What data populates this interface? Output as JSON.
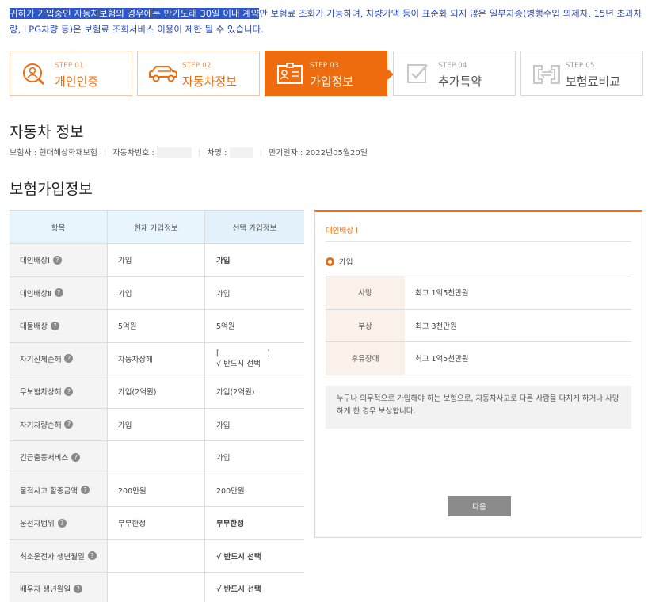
{
  "notice": {
    "highlight": "귀하가 가입중인 자동차보험의 경우에는 만기도래 30일 이내 계약",
    "rest": "만 보험료 조회가 가능하며, 차량가액 등이 표준화 되지 않은 일부차종(병행수입 외제차, 15년 초과차량, LPG차량 등)은 보험료 조회서비스 이용이 제한 될 수 있습니다."
  },
  "steps": [
    {
      "num": "STEP 01",
      "label": "개인인증",
      "state": "done",
      "icon": "person-search-icon"
    },
    {
      "num": "STEP 02",
      "label": "자동차정보",
      "state": "done",
      "icon": "car-icon"
    },
    {
      "num": "STEP 03",
      "label": "가입정보",
      "state": "active",
      "icon": "id-card-icon"
    },
    {
      "num": "STEP 04",
      "label": "추가특약",
      "state": "todo",
      "icon": "checkbox-icon"
    },
    {
      "num": "STEP 05",
      "label": "보험료비교",
      "state": "todo",
      "icon": "compare-icon"
    }
  ],
  "car_section": {
    "title": "자동차 정보",
    "insurer": "보험사 : 현대해상화재보험",
    "plate_label": "자동차번호 :",
    "model_label": "차명 :",
    "expiry": "만기일자 : 2022년05월20일"
  },
  "plan_section": {
    "title": "보험가입정보"
  },
  "table": {
    "headers": [
      "항목",
      "현재 가입정보",
      "선택 가입정보"
    ],
    "rows": [
      {
        "item": "대인배상Ⅰ",
        "current": "가입",
        "selected": "가입",
        "style": "orange"
      },
      {
        "item": "대인배상Ⅱ",
        "current": "가입",
        "selected": "가입",
        "style": ""
      },
      {
        "item": "대물배상",
        "current": "5억원",
        "selected": "5억원",
        "style": ""
      },
      {
        "item": "자기신체손해",
        "current": "자동차상해",
        "selected": "[                    ]",
        "selected2": "√ 반드시 선택",
        "style": "stack"
      },
      {
        "item": "무보험차상해",
        "current": "가입(2억원)",
        "selected": "가입(2억원)",
        "style": ""
      },
      {
        "item": "자기차량손해",
        "current": "가입",
        "selected": "가입",
        "style": ""
      },
      {
        "item": "긴급출동서비스",
        "current": "",
        "selected": "가입",
        "style": ""
      },
      {
        "item": "물적사고 할증금액",
        "current": "200만원",
        "selected": "200만원",
        "style": ""
      },
      {
        "item": "운전자범위",
        "current": "부부한정",
        "selected": "부부한정",
        "style": "bold"
      },
      {
        "item": "최소운전자 생년월일",
        "current": "",
        "selected": "√ 반드시 선택",
        "style": "bold"
      },
      {
        "item": "배우자 생년월일",
        "current": "",
        "selected": "√ 반드시 선택",
        "style": "bold"
      }
    ]
  },
  "detail_panel": {
    "title": "대인배상 I",
    "option": "가입",
    "rows": [
      {
        "key": "사망",
        "value": "최고 1억5천만원"
      },
      {
        "key": "부상",
        "value": "최고 3천만원"
      },
      {
        "key": "후유장애",
        "value": "최고 1억5천만원"
      }
    ],
    "description": "누구나 의무적으로 가입해야 하는 보험으로, 자동차사고로 다른 사람을 다치게 하거나 사망하게 한 경우 보상합니다.",
    "next_label": "다음"
  },
  "colors": {
    "accent": "#ee6c0e",
    "notice": "#2a4ab3",
    "highlight": "#2c56c9"
  },
  "help_glyph": "?"
}
